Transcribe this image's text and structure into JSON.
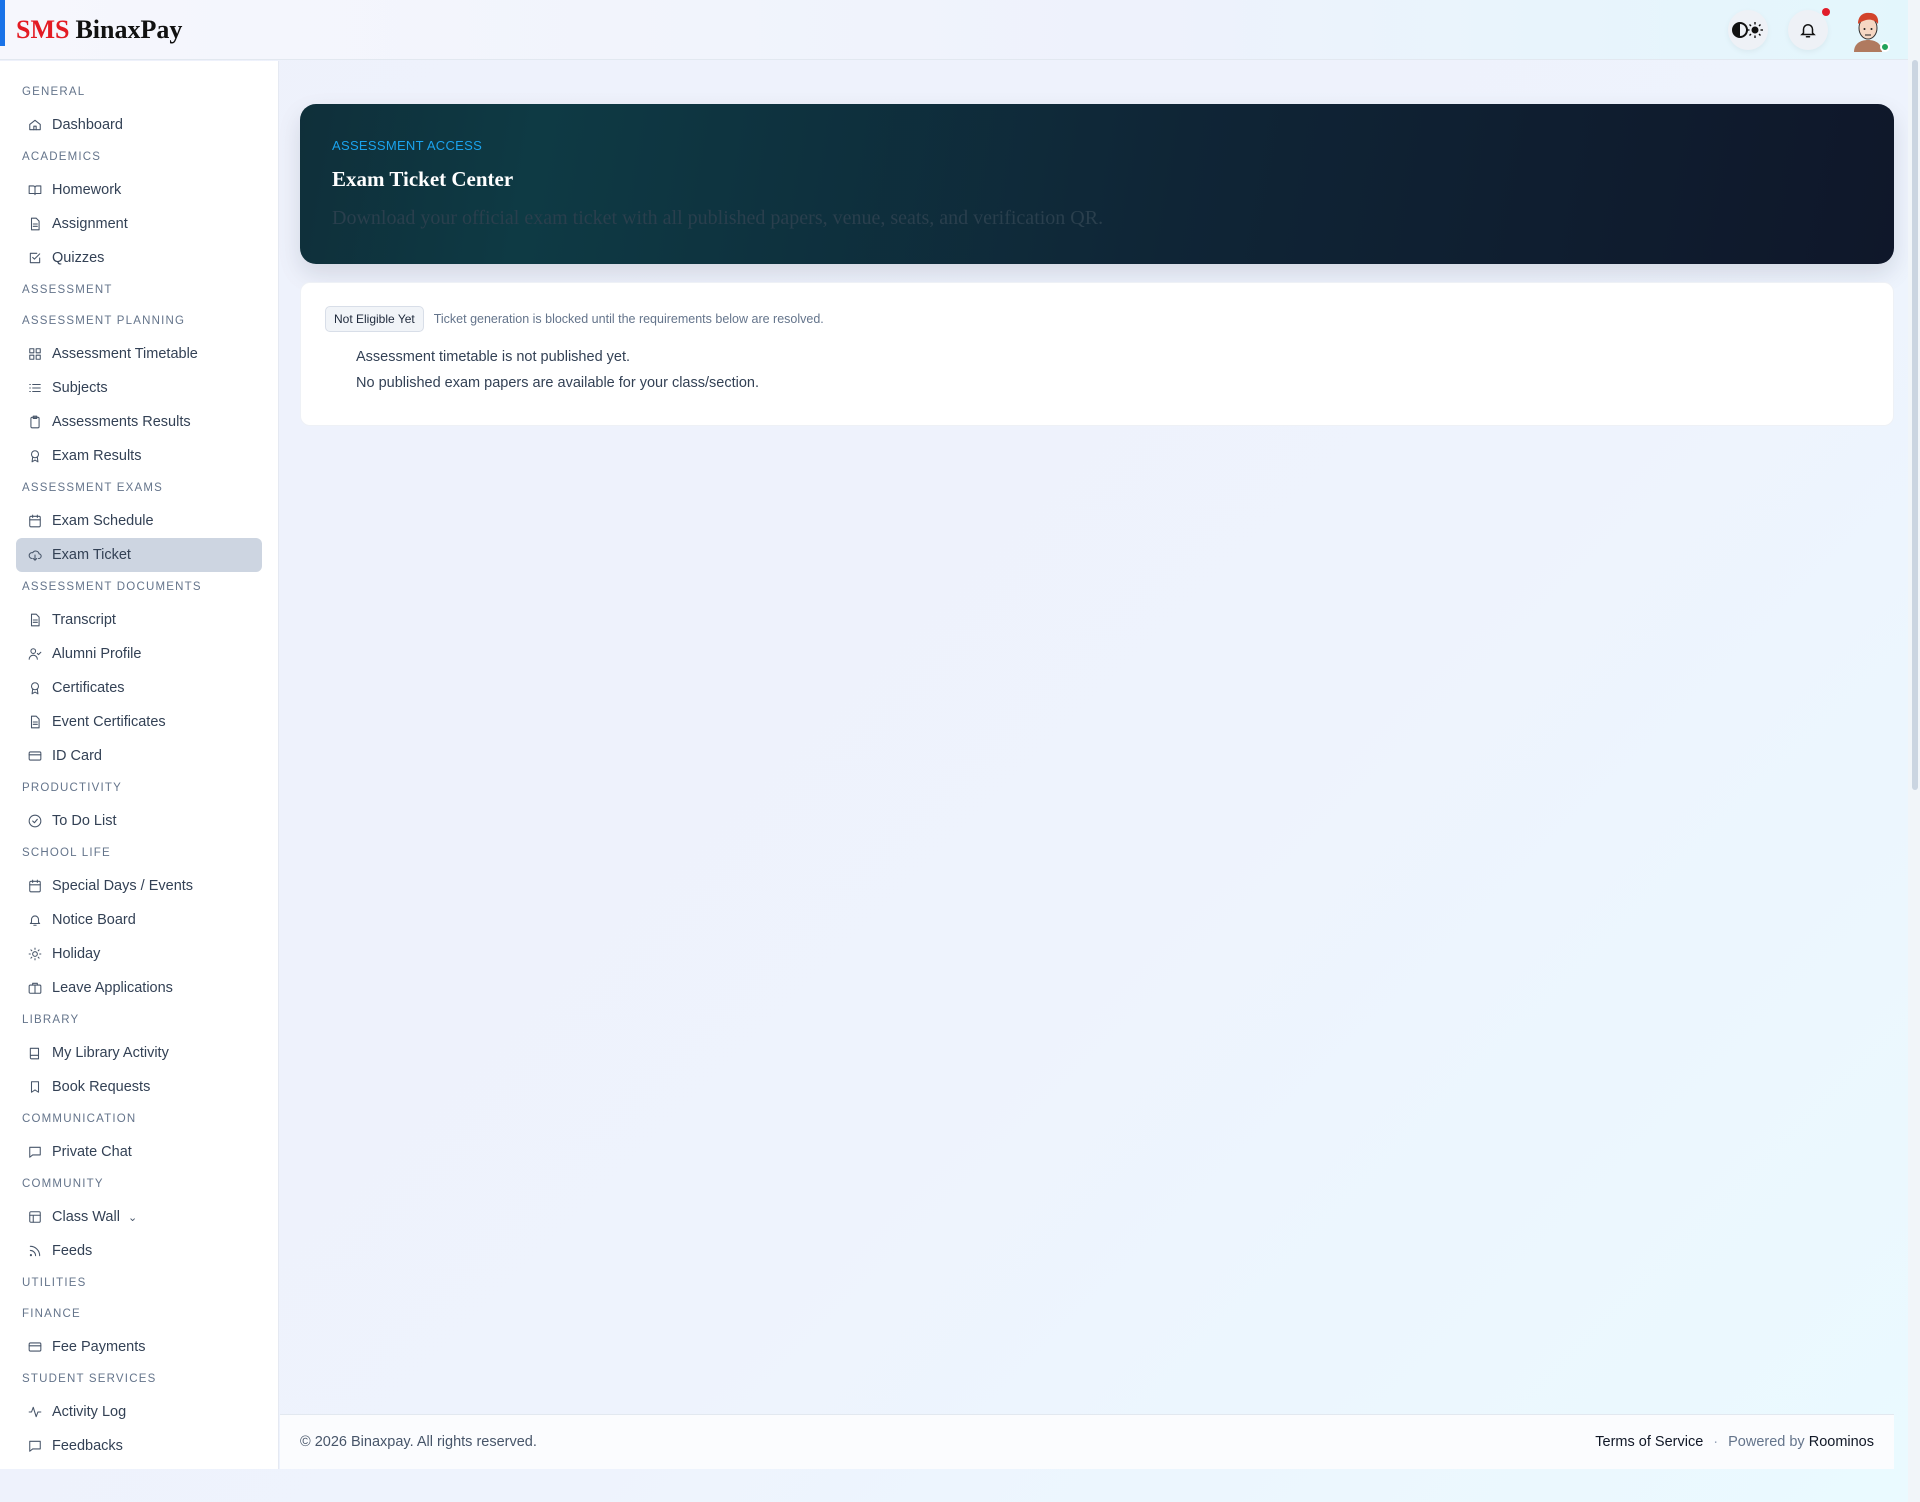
{
  "header": {
    "logo_red": "SMS",
    "logo_dark": "BinaxPay",
    "icons": [
      "theme-toggle-icon",
      "bell-icon",
      "avatar"
    ],
    "notification_dot_color": "#e11d2a",
    "online_color": "#22a35a"
  },
  "sidebar": [
    {
      "type": "section",
      "label": "GENERAL"
    },
    {
      "type": "item",
      "label": "Dashboard",
      "icon": "home"
    },
    {
      "type": "section",
      "label": "ACADEMICS"
    },
    {
      "type": "item",
      "label": "Homework",
      "icon": "book"
    },
    {
      "type": "item",
      "label": "Assignment",
      "icon": "file"
    },
    {
      "type": "item",
      "label": "Quizzes",
      "icon": "check-square"
    },
    {
      "type": "section",
      "label": "ASSESSMENT"
    },
    {
      "type": "section",
      "label": "ASSESSMENT PLANNING"
    },
    {
      "type": "item",
      "label": "Assessment Timetable",
      "icon": "grid"
    },
    {
      "type": "item",
      "label": "Subjects",
      "icon": "list"
    },
    {
      "type": "item",
      "label": "Assessments Results",
      "icon": "clipboard"
    },
    {
      "type": "item",
      "label": "Exam Results",
      "icon": "award"
    },
    {
      "type": "section",
      "label": "ASSESSMENT EXAMS"
    },
    {
      "type": "item",
      "label": "Exam Schedule",
      "icon": "calendar"
    },
    {
      "type": "item",
      "label": "Exam Ticket",
      "icon": "cloud-download",
      "active": true
    },
    {
      "type": "section",
      "label": "ASSESSMENT DOCUMENTS"
    },
    {
      "type": "item",
      "label": "Transcript",
      "icon": "file"
    },
    {
      "type": "item",
      "label": "Alumni Profile",
      "icon": "user-check"
    },
    {
      "type": "item",
      "label": "Certificates",
      "icon": "award"
    },
    {
      "type": "item",
      "label": "Event Certificates",
      "icon": "file"
    },
    {
      "type": "item",
      "label": "ID Card",
      "icon": "card"
    },
    {
      "type": "section",
      "label": "PRODUCTIVITY"
    },
    {
      "type": "item",
      "label": "To Do List",
      "icon": "check-circle"
    },
    {
      "type": "section",
      "label": "SCHOOL LIFE"
    },
    {
      "type": "item",
      "label": "Special Days / Events",
      "icon": "calendar"
    },
    {
      "type": "item",
      "label": "Notice Board",
      "icon": "bell"
    },
    {
      "type": "item",
      "label": "Holiday",
      "icon": "sun"
    },
    {
      "type": "item",
      "label": "Leave Applications",
      "icon": "briefcase"
    },
    {
      "type": "section",
      "label": "LIBRARY"
    },
    {
      "type": "item",
      "label": "My Library Activity",
      "icon": "book-closed"
    },
    {
      "type": "item",
      "label": "Book Requests",
      "icon": "bookmark"
    },
    {
      "type": "section",
      "label": "COMMUNICATION"
    },
    {
      "type": "item",
      "label": "Private Chat",
      "icon": "message"
    },
    {
      "type": "section",
      "label": "COMMUNITY"
    },
    {
      "type": "item",
      "label": "Class Wall",
      "icon": "layout",
      "dropdown": true
    },
    {
      "type": "item",
      "label": "Feeds",
      "icon": "rss"
    },
    {
      "type": "section",
      "label": "UTILITIES"
    },
    {
      "type": "section",
      "label": "FINANCE"
    },
    {
      "type": "item",
      "label": "Fee Payments",
      "icon": "card"
    },
    {
      "type": "section",
      "label": "STUDENT SERVICES"
    },
    {
      "type": "item",
      "label": "Activity Log",
      "icon": "activity"
    },
    {
      "type": "item",
      "label": "Feedbacks",
      "icon": "message"
    }
  ],
  "banner": {
    "eyebrow": "ASSESSMENT ACCESS",
    "title": "Exam Ticket Center",
    "subtitle": "Download your official exam ticket with all published papers, venue, seats, and verification QR."
  },
  "status": {
    "badge": "Not Eligible Yet",
    "note": "Ticket generation is blocked until the requirements below are resolved.",
    "requirements": [
      "Assessment timetable is not published yet.",
      "No published exam papers are available for your class/section."
    ]
  },
  "footer": {
    "copyright": "© 2026 Binaxpay. All rights reserved.",
    "terms": "Terms of Service",
    "separator": "·",
    "powered_by": "Powered by",
    "brand": "Roominos"
  }
}
